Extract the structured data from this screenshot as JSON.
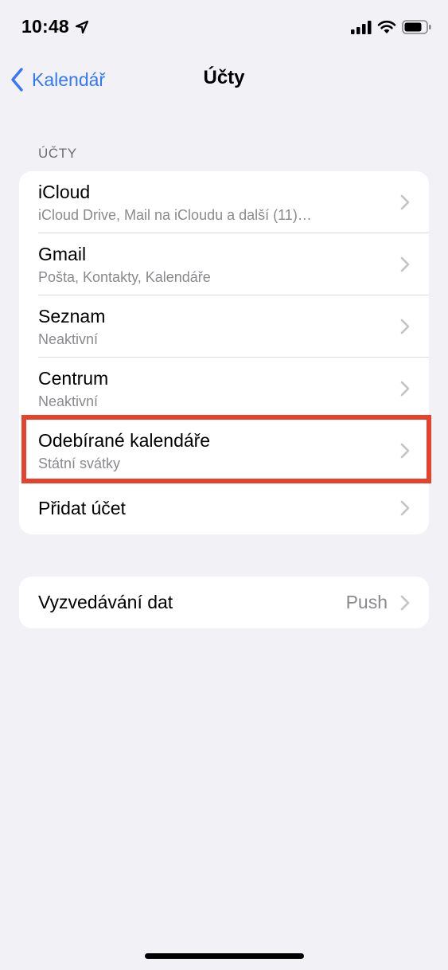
{
  "status_bar": {
    "time": "10:48"
  },
  "nav": {
    "back_label": "Kalendář",
    "title": "Účty"
  },
  "accounts_section": {
    "header": "ÚČTY",
    "rows": [
      {
        "title": "iCloud",
        "subtitle": "iCloud Drive, Mail na iCloudu a další (11)…"
      },
      {
        "title": "Gmail",
        "subtitle": "Pošta, Kontakty, Kalendáře"
      },
      {
        "title": "Seznam",
        "subtitle": "Neaktivní"
      },
      {
        "title": "Centrum",
        "subtitle": "Neaktivní"
      },
      {
        "title": "Odebírané kalendáře",
        "subtitle": "Státní svátky"
      }
    ],
    "add_account": "Přidat účet"
  },
  "fetch_section": {
    "label": "Vyzvedávání dat",
    "value": "Push"
  },
  "colors": {
    "accent": "#3478f6",
    "highlight": "#e5432c",
    "background": "#f2f1f6"
  }
}
